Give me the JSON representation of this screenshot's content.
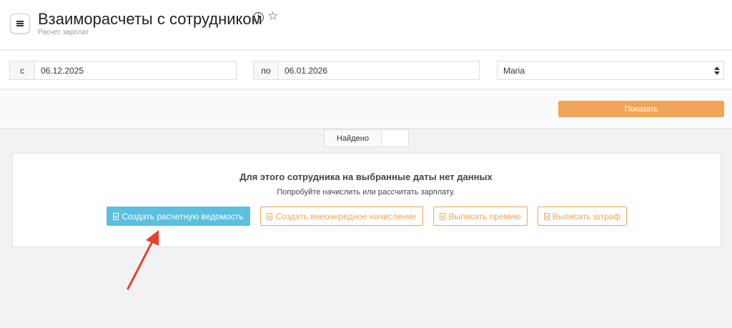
{
  "header": {
    "title": "Взаиморасчеты с сотрудником",
    "subtitle": "Расчет зарплат",
    "info_glyph": "i",
    "star_glyph": "☆"
  },
  "filters": {
    "from_label": "с",
    "from_value": "06.12.2025",
    "to_label": "по",
    "to_value": "06.01.2026",
    "employee_selected": "Maria"
  },
  "actions": {
    "show_label": "Показать"
  },
  "results": {
    "found_label": "Найдено",
    "found_count": ""
  },
  "empty_state": {
    "title": "Для этого сотрудника на выбранные даты нет данных",
    "hint": "Попробуйте начислить или рассчитать зарплату.",
    "buttons": [
      {
        "label": "Создать расчетную ведомость",
        "icon": "document-icon"
      },
      {
        "label": "Создать внеочередное начисление",
        "icon": "note-icon"
      },
      {
        "label": "Выписать премию",
        "icon": "note-icon"
      },
      {
        "label": "Выписать штраф",
        "icon": "note-icon"
      }
    ]
  },
  "colors": {
    "accent_orange": "#f0a55a",
    "primary_blue": "#5bc0de",
    "annotation_arrow": "#e8402a"
  }
}
